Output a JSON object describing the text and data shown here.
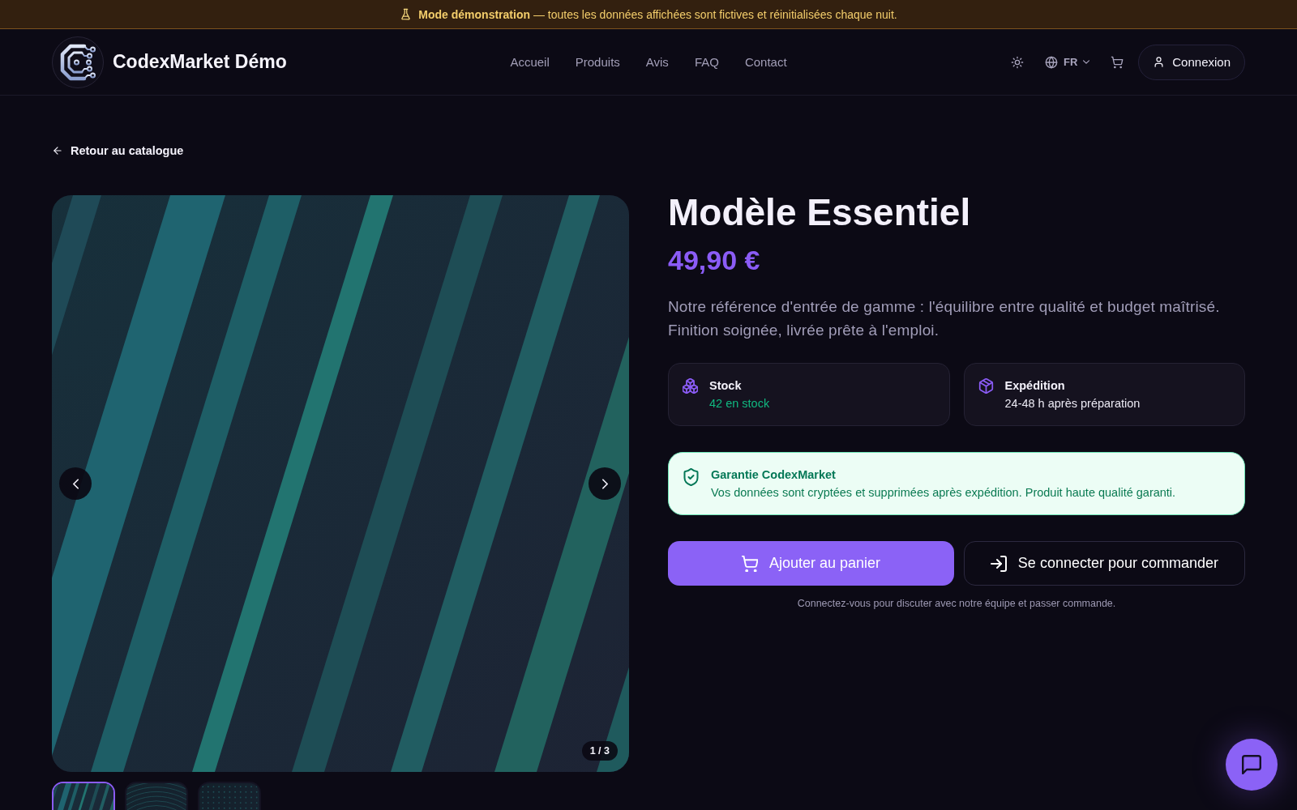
{
  "banner": {
    "text": "**Mode démonstration** — toutes les données affichées sont fictives et réinitialisées chaque nuit."
  },
  "header": {
    "brand": "CodexMarket Démo",
    "nav": [
      {
        "label": "Accueil"
      },
      {
        "label": "Produits"
      },
      {
        "label": "Avis"
      },
      {
        "label": "FAQ"
      },
      {
        "label": "Contact"
      }
    ],
    "language": "FR",
    "login_button": "Connexion"
  },
  "back_link": "Retour au catalogue",
  "gallery": {
    "counter": "1 / 3",
    "thumbnails": [
      {
        "kind": "stripes",
        "selected": true
      },
      {
        "kind": "rings",
        "selected": false
      },
      {
        "kind": "dots",
        "selected": false
      }
    ]
  },
  "product": {
    "title": "Modèle Essentiel",
    "price": "49,90 €",
    "description": "Notre référence d'entrée de gamme : l'équilibre entre qualité et budget maîtrisé. Finition soignée, livrée prête à l'emploi.",
    "info_cards": [
      {
        "kind": "stock",
        "title": "Stock",
        "value": "42 en stock"
      },
      {
        "kind": "shipping",
        "title": "Expédition",
        "value": "24-48 h après préparation"
      }
    ],
    "guarantee": {
      "title": "Garantie CodexMarket",
      "text": "Vos données sont cryptées et supprimées après expédition. Produit haute qualité garanti."
    },
    "actions": [
      {
        "kind": "primary",
        "label": "Ajouter au panier"
      },
      {
        "kind": "secondary",
        "label": "Se connecter pour commander"
      }
    ],
    "note": "Connectez-vous pour discuter avec notre équipe et passer commande."
  }
}
